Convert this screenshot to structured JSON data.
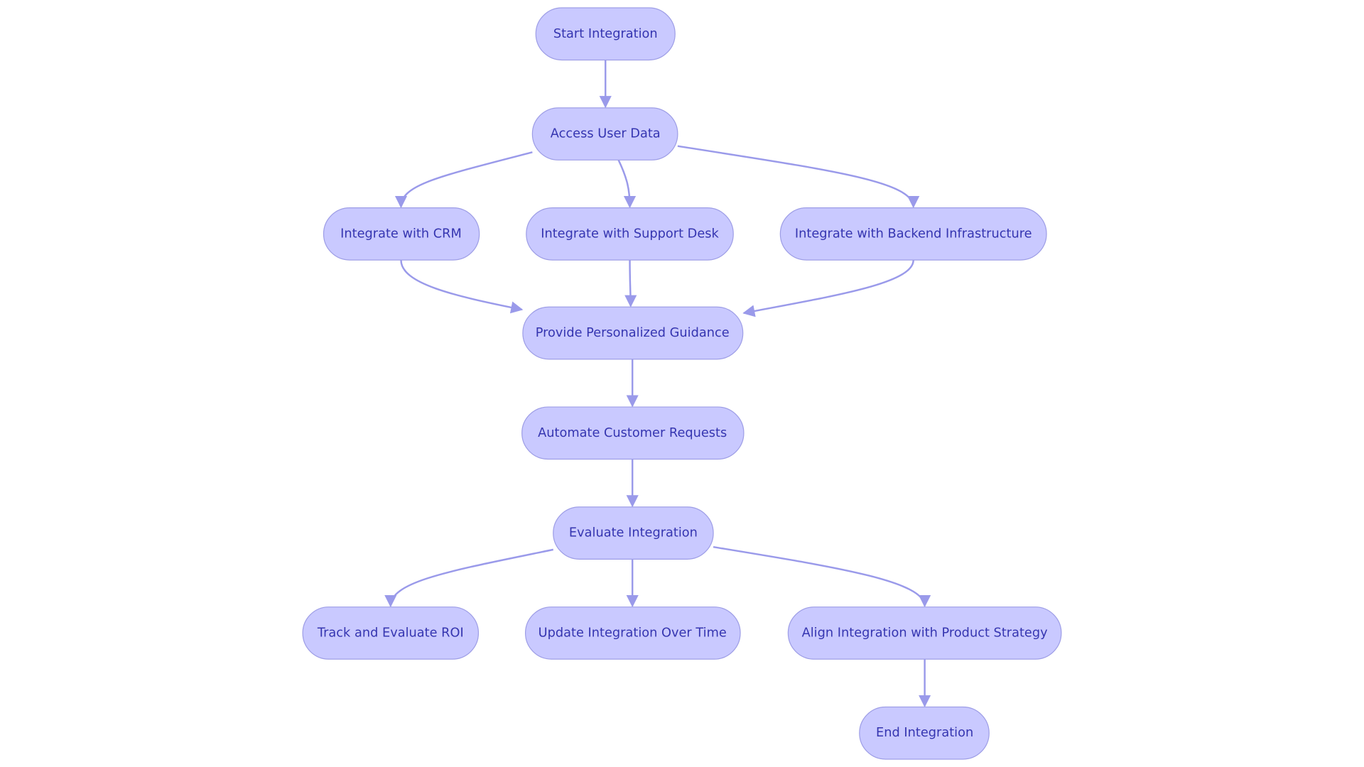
{
  "colors": {
    "node_fill": "#c9c9ff",
    "node_stroke": "#9e9ee6",
    "edge": "#9a9aea",
    "text": "#3535b0"
  },
  "nodes": {
    "start": "Start Integration",
    "access": "Access User Data",
    "crm": "Integrate with CRM",
    "support": "Integrate with Support Desk",
    "backend": "Integrate with Backend Infrastructure",
    "guidance": "Provide Personalized Guidance",
    "automate": "Automate Customer Requests",
    "evaluate": "Evaluate Integration",
    "roi": "Track and Evaluate ROI",
    "update": "Update Integration Over Time",
    "align": "Align Integration with Product Strategy",
    "end": "End Integration"
  },
  "edges": [
    [
      "start",
      "access"
    ],
    [
      "access",
      "crm"
    ],
    [
      "access",
      "support"
    ],
    [
      "access",
      "backend"
    ],
    [
      "crm",
      "guidance"
    ],
    [
      "support",
      "guidance"
    ],
    [
      "backend",
      "guidance"
    ],
    [
      "guidance",
      "automate"
    ],
    [
      "automate",
      "evaluate"
    ],
    [
      "evaluate",
      "roi"
    ],
    [
      "evaluate",
      "update"
    ],
    [
      "evaluate",
      "align"
    ],
    [
      "align",
      "end"
    ]
  ]
}
